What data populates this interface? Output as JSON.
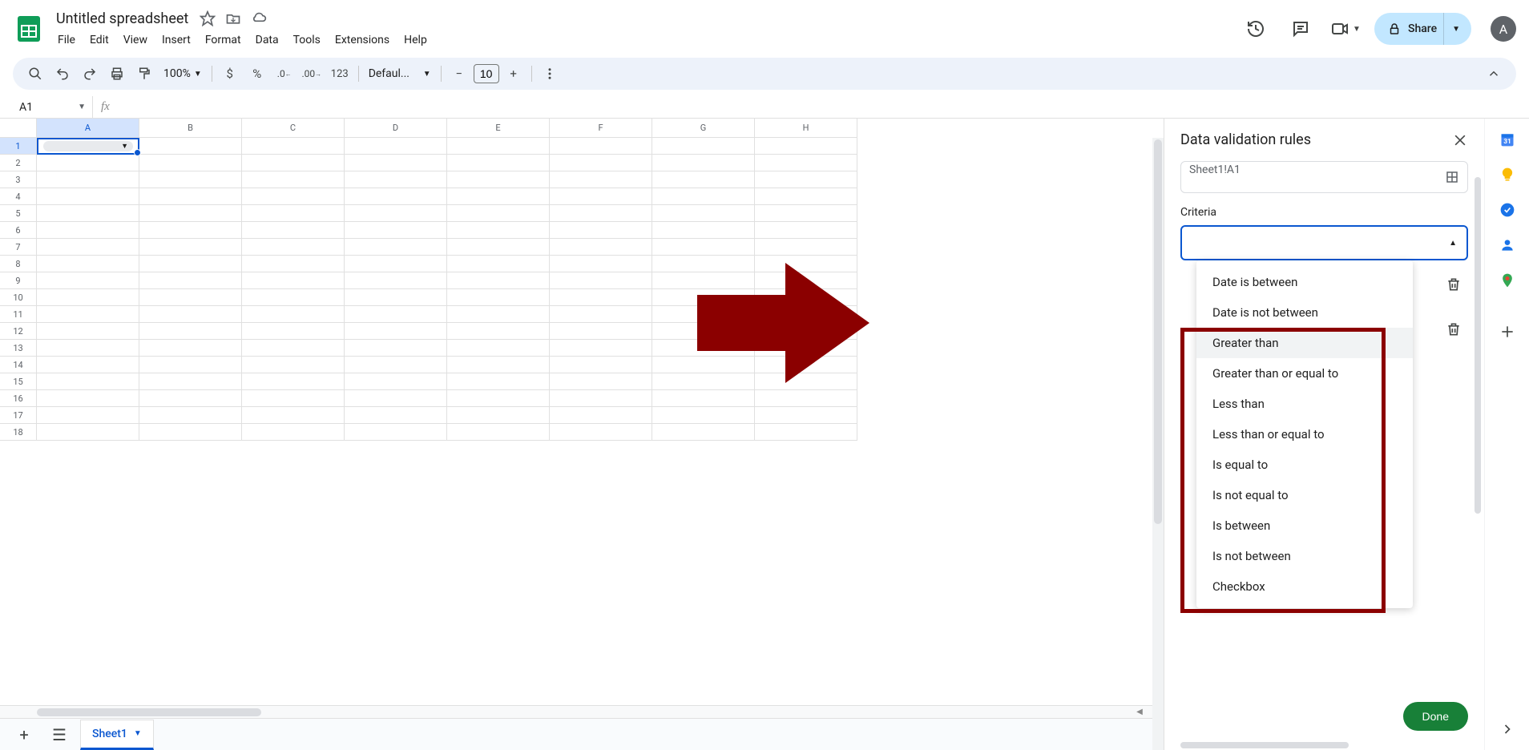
{
  "doc": {
    "title": "Untitled spreadsheet"
  },
  "menus": [
    "File",
    "Edit",
    "View",
    "Insert",
    "Format",
    "Data",
    "Tools",
    "Extensions",
    "Help"
  ],
  "toolbar": {
    "zoom": "100%",
    "currency": "$",
    "percent": "%",
    "font": "Defaul...",
    "fontsize": "10",
    "numfmt": "123"
  },
  "namebox": "A1",
  "share_label": "Share",
  "avatar_initial": "A",
  "columns": [
    "A",
    "B",
    "C",
    "D",
    "E",
    "F",
    "G",
    "H"
  ],
  "rows": [
    "1",
    "2",
    "3",
    "4",
    "5",
    "6",
    "7",
    "8",
    "9",
    "10",
    "11",
    "12",
    "13",
    "14",
    "15",
    "16",
    "17",
    "18"
  ],
  "sheet_tab": "Sheet1",
  "sidebar": {
    "title": "Data validation rules",
    "range": "Sheet1!A1",
    "criteria_label": "Criteria",
    "done": "Done",
    "options": [
      "Date is between",
      "Date is not between",
      "Greater than",
      "Greater than or equal to",
      "Less than",
      "Less than or equal to",
      "Is equal to",
      "Is not equal to",
      "Is between",
      "Is not between",
      "Checkbox"
    ]
  },
  "rail": {
    "calendar_day": "31"
  }
}
